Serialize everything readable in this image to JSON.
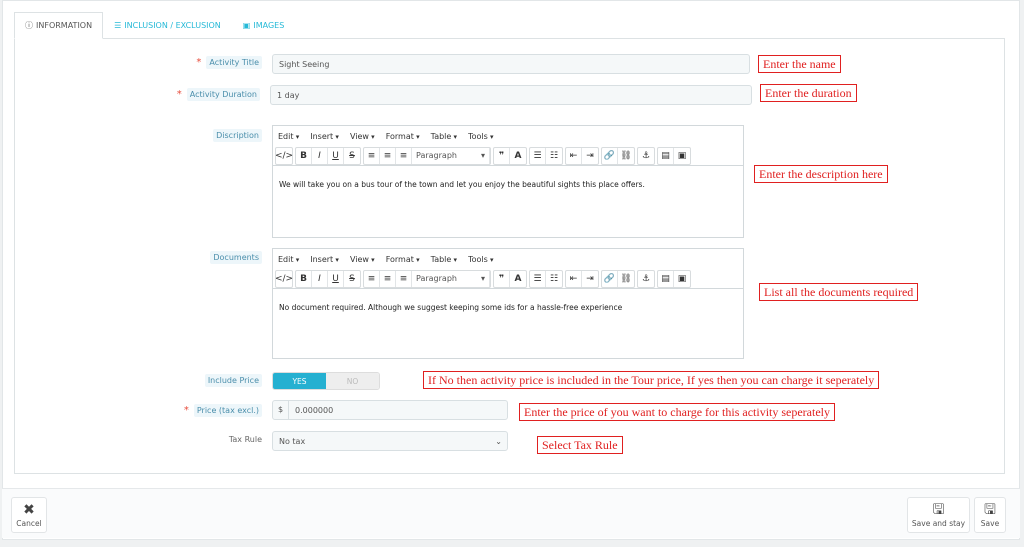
{
  "tabs": [
    {
      "label": "INFORMATION",
      "icon": "info-circle-icon"
    },
    {
      "label": "INCLUSION / EXCLUSION",
      "icon": "list-icon"
    },
    {
      "label": "IMAGES",
      "icon": "image-icon"
    }
  ],
  "fields": {
    "title": {
      "label": "Activity Title",
      "value": "Sight Seeing",
      "note": "Enter the name"
    },
    "duration": {
      "label": "Activity Duration",
      "value": "1 day",
      "note": "Enter the duration"
    },
    "description": {
      "label": "Discription",
      "value": "We will take you on a bus tour of the town and let you enjoy the beautiful sights this place offers.",
      "note": "Enter the description here"
    },
    "documents": {
      "label": "Documents",
      "value": "No document required. Although we suggest keeping some ids for a hassle-free experience",
      "note": "List all the documents required"
    },
    "include_price": {
      "label": "Include Price",
      "yes": "YES",
      "no": "NO",
      "selected": "YES",
      "note": "If No then activity price is included in the Tour price, If yes then you can charge it seperately"
    },
    "price": {
      "label": "Price (tax excl.)",
      "currency": "$",
      "value": "0.000000",
      "note": "Enter the price of you want to charge for this activity seperately"
    },
    "tax": {
      "label": "Tax Rule",
      "value": "No tax",
      "note": "Select Tax Rule"
    }
  },
  "editor": {
    "menus": [
      "Edit",
      "Insert",
      "View",
      "Format",
      "Table",
      "Tools"
    ],
    "format": "Paragraph"
  },
  "footer": {
    "cancel": "Cancel",
    "save_stay": "Save and stay",
    "save": "Save"
  },
  "colors": {
    "accent": "#25b0d1",
    "annotation": "#e02020",
    "required": "#e74c3c"
  }
}
